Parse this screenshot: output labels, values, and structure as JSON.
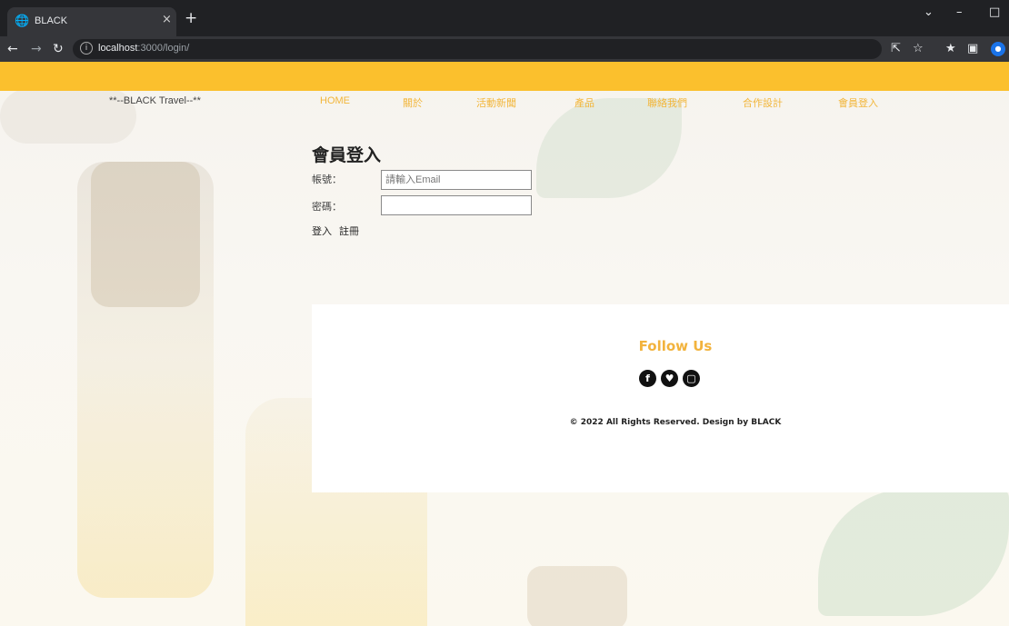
{
  "browser": {
    "tab_title": "BLACK",
    "tab_close": "×",
    "new_tab": "+",
    "url_host": "localhost",
    "url_rest": ":3000/login/",
    "icons": [
      "back-icon",
      "forward-icon",
      "reload-icon",
      "info-icon",
      "share-icon",
      "star-icon",
      "extensions-icon",
      "sidepanel-icon",
      "profile-icon"
    ]
  },
  "nav": {
    "brand": "**--BLACK Travel--**",
    "items": [
      "HOME",
      "關於",
      "活動新聞",
      "產品",
      "聯絡我們",
      "合作設計",
      "會員登入"
    ]
  },
  "login": {
    "title": "會員登入",
    "account_label": "帳號：",
    "account_placeholder": "請輸入Email",
    "password_label": "密碼：",
    "password_value": "",
    "login_link": "登入",
    "register_link": "註冊"
  },
  "footer": {
    "follow_title": "Follow Us",
    "social_icons": [
      "facebook-icon",
      "twitter-icon",
      "instagram-icon"
    ],
    "copyright": "© 2022 All Rights Reserved. Design by BLACK"
  },
  "colors": {
    "accent": "#fbc02d",
    "nav_text": "#f2b63a",
    "follow_title": "#f2b33d"
  }
}
